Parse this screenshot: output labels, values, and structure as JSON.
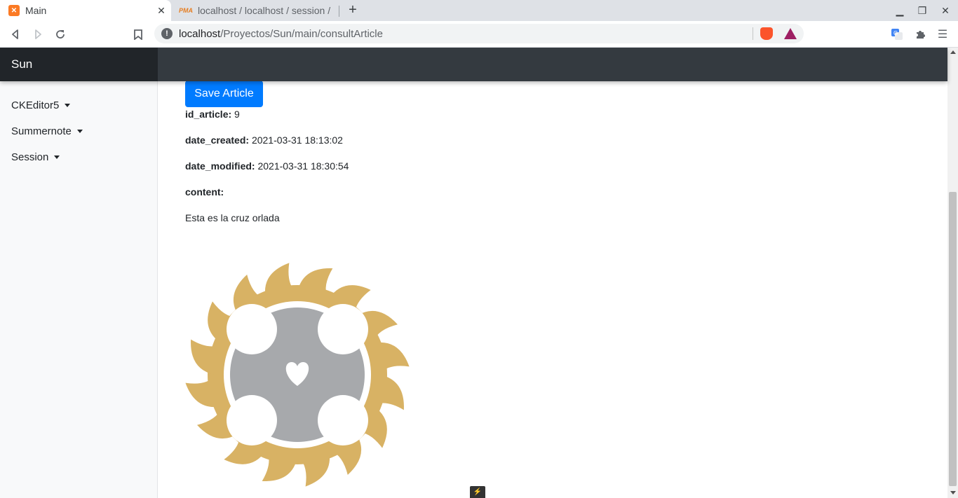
{
  "browser": {
    "tabs": [
      {
        "title": "Main",
        "favicon": "xampp-icon",
        "active": true
      },
      {
        "title": "localhost / localhost / session /",
        "favicon": "phpmyadmin-icon",
        "active": false
      }
    ],
    "new_tab": "+",
    "url": {
      "host": "localhost",
      "path": "/Proyectos/Sun/main/consultArticle"
    }
  },
  "navbar": {
    "brand": "Sun"
  },
  "sidebar": {
    "items": [
      {
        "label": "CKEditor5"
      },
      {
        "label": "Summernote"
      },
      {
        "label": "Session"
      }
    ]
  },
  "article": {
    "save_label": "Save Article",
    "fields": [
      {
        "key": "id_article:",
        "value": "9"
      },
      {
        "key": "date_created:",
        "value": "2021-03-31 18:13:02"
      },
      {
        "key": "date_modified:",
        "value": "2021-03-31 18:30:54"
      },
      {
        "key": "content:",
        "value": ""
      }
    ],
    "content_text": "Esta es la cruz orlada",
    "image_colors": {
      "rays": "#d8b264",
      "cross": "#a7a9ac",
      "ring": "#ffffff"
    }
  },
  "colors": {
    "navbar": "#343a40",
    "brand_bg": "#212529",
    "primary": "#007bff",
    "sidebar_bg": "#f8f9fa"
  }
}
